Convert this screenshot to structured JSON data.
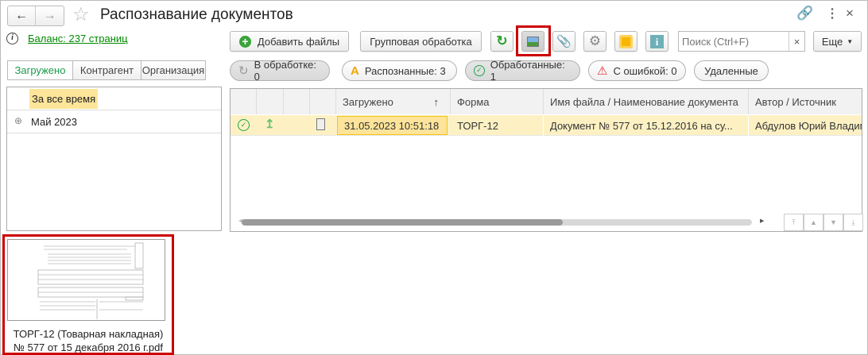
{
  "window": {
    "title": "Распознавание документов"
  },
  "balance": {
    "label": "Баланс: 237 страниц"
  },
  "toolbar": {
    "add_files": "Добавить файлы",
    "group_processing": "Групповая обработка",
    "search_placeholder": "Поиск (Ctrl+F)",
    "search_clear": "×",
    "more": "Еще"
  },
  "filters": [
    {
      "label": "В обработке: 0"
    },
    {
      "label": "Распознанные: 3"
    },
    {
      "label": "Обработанные: 1"
    },
    {
      "label": "С ошибкой: 0"
    },
    {
      "label": "Удаленные"
    }
  ],
  "tabs": [
    {
      "label": "Загружено",
      "active": true
    },
    {
      "label": "Контрагент"
    },
    {
      "label": "Организация"
    }
  ],
  "tree": {
    "items": [
      {
        "label": "За все время",
        "selected": true
      },
      {
        "label": "Май 2023",
        "expand": "⊕"
      }
    ]
  },
  "table": {
    "columns": [
      "",
      "",
      "",
      "",
      "Загружено",
      "Форма",
      "Имя файла / Наименование документа",
      "Автор / Источник"
    ],
    "sort_indicator": "↑",
    "rows": [
      {
        "uploaded": "31.05.2023 10:51:18",
        "form": "ТОРГ-12",
        "name": "Документ № 577 от 15.12.2016 на су...",
        "author": "Абдулов Юрий Владимирович",
        "status": "processed"
      }
    ]
  },
  "preview": {
    "caption_line1": "ТОРГ-12 (Товарная накладная)",
    "caption_line2": "№ 577 от 15 декабря 2016 г.pdf"
  },
  "colors": {
    "link": "#008a00",
    "highlight": "#fdf1c4",
    "selected_cell": "#fde49a",
    "annotation": "#cc0000"
  }
}
